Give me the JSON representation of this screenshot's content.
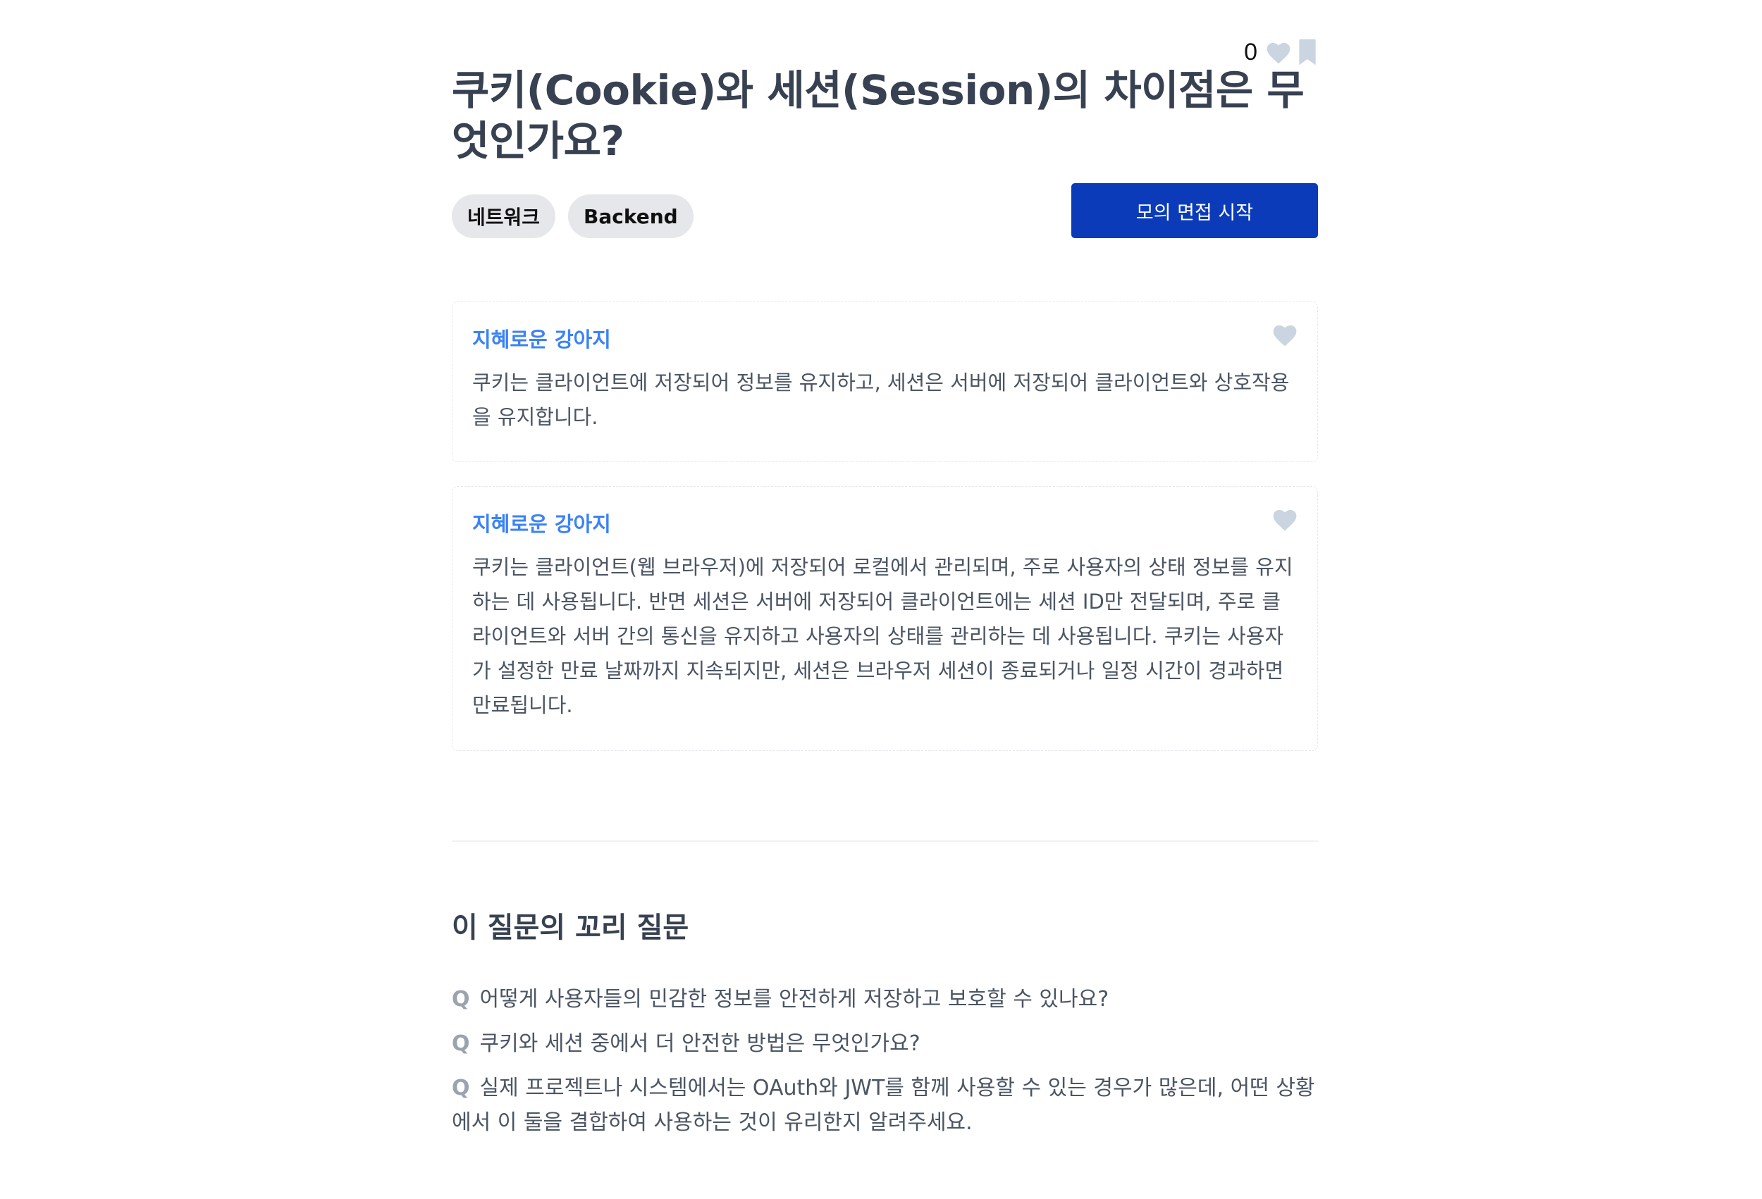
{
  "question": {
    "like_count": "0",
    "title": "쿠키(Cookie)와 세션(Session)의 차이점은 무엇인가요?",
    "tags": [
      "네트워크",
      "Backend"
    ],
    "start_button_label": "모의 면접 시작"
  },
  "answers": [
    {
      "author": "지혜로운 강아지",
      "text": "쿠키는 클라이언트에 저장되어 정보를 유지하고, 세션은 서버에 저장되어 클라이언트와 상호작용을 유지합니다."
    },
    {
      "author": "지혜로운 강아지",
      "text": "쿠키는 클라이언트(웹 브라우저)에 저장되어 로컬에서 관리되며, 주로 사용자의 상태 정보를 유지하는 데 사용됩니다. 반면 세션은 서버에 저장되어 클라이언트에는 세션 ID만 전달되며, 주로 클라이언트와 서버 간의 통신을 유지하고 사용자의 상태를 관리하는 데 사용됩니다. 쿠키는 사용자가 설정한 만료 날짜까지 지속되지만, 세션은 브라우저 세션이 종료되거나 일정 시간이 경과하면 만료됩니다."
    }
  ],
  "followup": {
    "section_title": "이 질문의 꼬리 질문",
    "prefix": "Q",
    "items": [
      "어떻게 사용자들의 민감한 정보를 안전하게 저장하고 보호할 수 있나요?",
      "쿠키와 세션 중에서 더 안전한 방법은 무엇인가요?",
      "실제 프로젝트나 시스템에서는 OAuth와 JWT를 함께 사용할 수 있는 경우가 많은데, 어떤 상황에서 이 둘을 결합하여 사용하는 것이 유리한지 알려주세요."
    ]
  },
  "icons": {
    "heart": "heart-icon",
    "bookmark": "bookmark-icon"
  },
  "colors": {
    "accent_button": "#0b3bb8",
    "author_link": "#3b82f6",
    "icon_inactive": "#cbd5e1",
    "tag_background": "#e5e7eb"
  }
}
